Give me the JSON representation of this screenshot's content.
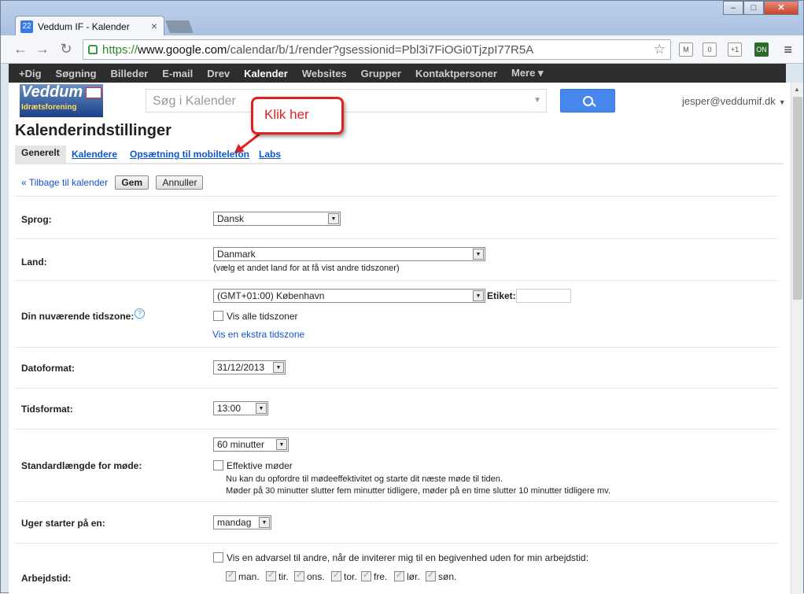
{
  "browser": {
    "tab_title": "Veddum IF - Kalender",
    "favicon_text": "22",
    "url_scheme": "https://",
    "url_host": "www.google.com",
    "url_path": "/calendar/b/1/render?gsessionid=Pbl3i7FiOGi0TjzpI77R5A",
    "ext_count": "0",
    "ext_on": "ON"
  },
  "gbar": {
    "items": [
      "+Dig",
      "Søgning",
      "Billeder",
      "E-mail",
      "Drev",
      "Kalender",
      "Websites",
      "Grupper",
      "Kontaktpersoner",
      "Mere ▾"
    ]
  },
  "header": {
    "logo_text": "Veddum",
    "logo_sub": "Idrætsforening",
    "search_placeholder": "Søg i Kalender",
    "user": "jesper@veddumif.dk",
    "page_title": "Kalenderindstillinger",
    "callout": "Klik   her"
  },
  "tabs": [
    "Generelt",
    "Kalendere",
    "Opsætning til mobiltelefon",
    "Labs"
  ],
  "actions": {
    "back": "« Tilbage til kalender",
    "save": "Gem",
    "cancel": "Annuller"
  },
  "settings": {
    "language": {
      "label": "Sprog:",
      "value": "Dansk"
    },
    "country": {
      "label": "Land:",
      "value": "Danmark",
      "hint": "(vælg et andet land for at få vist andre tidszoner)"
    },
    "timezone": {
      "label": "Din nuværende tidszone:",
      "value": "(GMT+01:00) København",
      "tag_label": "Etiket:",
      "show_all": "Vis alle tidszoner",
      "extra_link": "Vis en ekstra tidszone"
    },
    "date_format": {
      "label": "Datoformat:",
      "value": "31/12/2013"
    },
    "time_format": {
      "label": "Tidsformat:",
      "value": "13:00"
    },
    "meeting_length": {
      "label": "Standardlængde for møde:",
      "value": "60 minutter",
      "effective": "Effektive møder",
      "hint1": "Nu kan du opfordre til mødeeffektivitet og starte dit næste møde til tiden.",
      "hint2": "Møder på 30 minutter slutter fem minutter tidligere, møder på en time slutter 10 minutter tidligere mv."
    },
    "week_start": {
      "label": "Uger starter på en:",
      "value": "mandag"
    },
    "work_hours": {
      "label": "Arbejdstid:",
      "warn": "Vis en advarsel til andre, når de inviterer mig til en begivenhed uden for min arbejdstid:",
      "days": [
        "man.",
        "tir.",
        "ons.",
        "tor.",
        "fre.",
        "lør.",
        "søn."
      ]
    }
  }
}
